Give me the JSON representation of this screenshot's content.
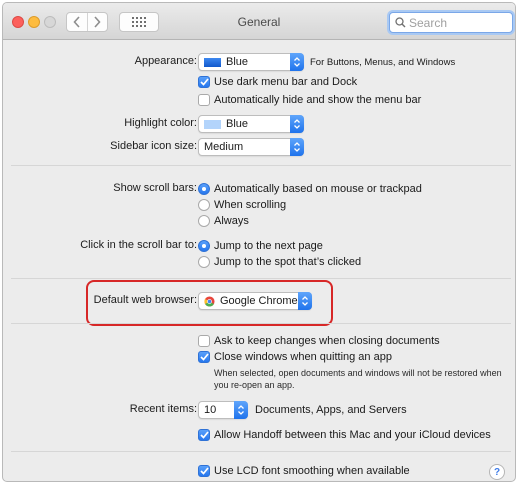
{
  "window": {
    "title": "General"
  },
  "search": {
    "placeholder": "Search"
  },
  "appearance": {
    "label": "Appearance:",
    "value": "Blue",
    "swatch_color": "#1f6fe0",
    "note": "For Buttons, Menus, and Windows",
    "dark_menu_label": "Use dark menu bar and Dock",
    "dark_menu_checked": true,
    "auto_hide_label": "Automatically hide and show the menu bar",
    "auto_hide_checked": false
  },
  "highlight_color": {
    "label": "Highlight color:",
    "value": "Blue",
    "swatch_color": "#b3d4fb"
  },
  "sidebar_icon_size": {
    "label": "Sidebar icon size:",
    "value": "Medium"
  },
  "scroll_bars": {
    "label": "Show scroll bars:",
    "options": [
      {
        "label": "Automatically based on mouse or trackpad",
        "selected": true
      },
      {
        "label": "When scrolling",
        "selected": false
      },
      {
        "label": "Always",
        "selected": false
      }
    ]
  },
  "scroll_click": {
    "label": "Click in the scroll bar to:",
    "options": [
      {
        "label": "Jump to the next page",
        "selected": true
      },
      {
        "label": "Jump to the spot that’s clicked",
        "selected": false
      }
    ]
  },
  "default_browser": {
    "label": "Default web browser:",
    "value": "Google Chrome"
  },
  "documents": {
    "ask_label": "Ask to keep changes when closing documents",
    "ask_checked": false,
    "close_label": "Close windows when quitting an app",
    "close_checked": true,
    "note": "When selected, open documents and windows will not be restored when you re-open an app."
  },
  "recent_items": {
    "label": "Recent items:",
    "value": "10",
    "suffix": "Documents, Apps, and Servers"
  },
  "handoff": {
    "label": "Allow Handoff between this Mac and your iCloud devices",
    "checked": true
  },
  "lcd": {
    "label": "Use LCD font smoothing when available",
    "checked": true
  },
  "help": {
    "label": "?"
  },
  "colors": {
    "accent": "#2677ee",
    "highlight_border": "#d72727"
  }
}
